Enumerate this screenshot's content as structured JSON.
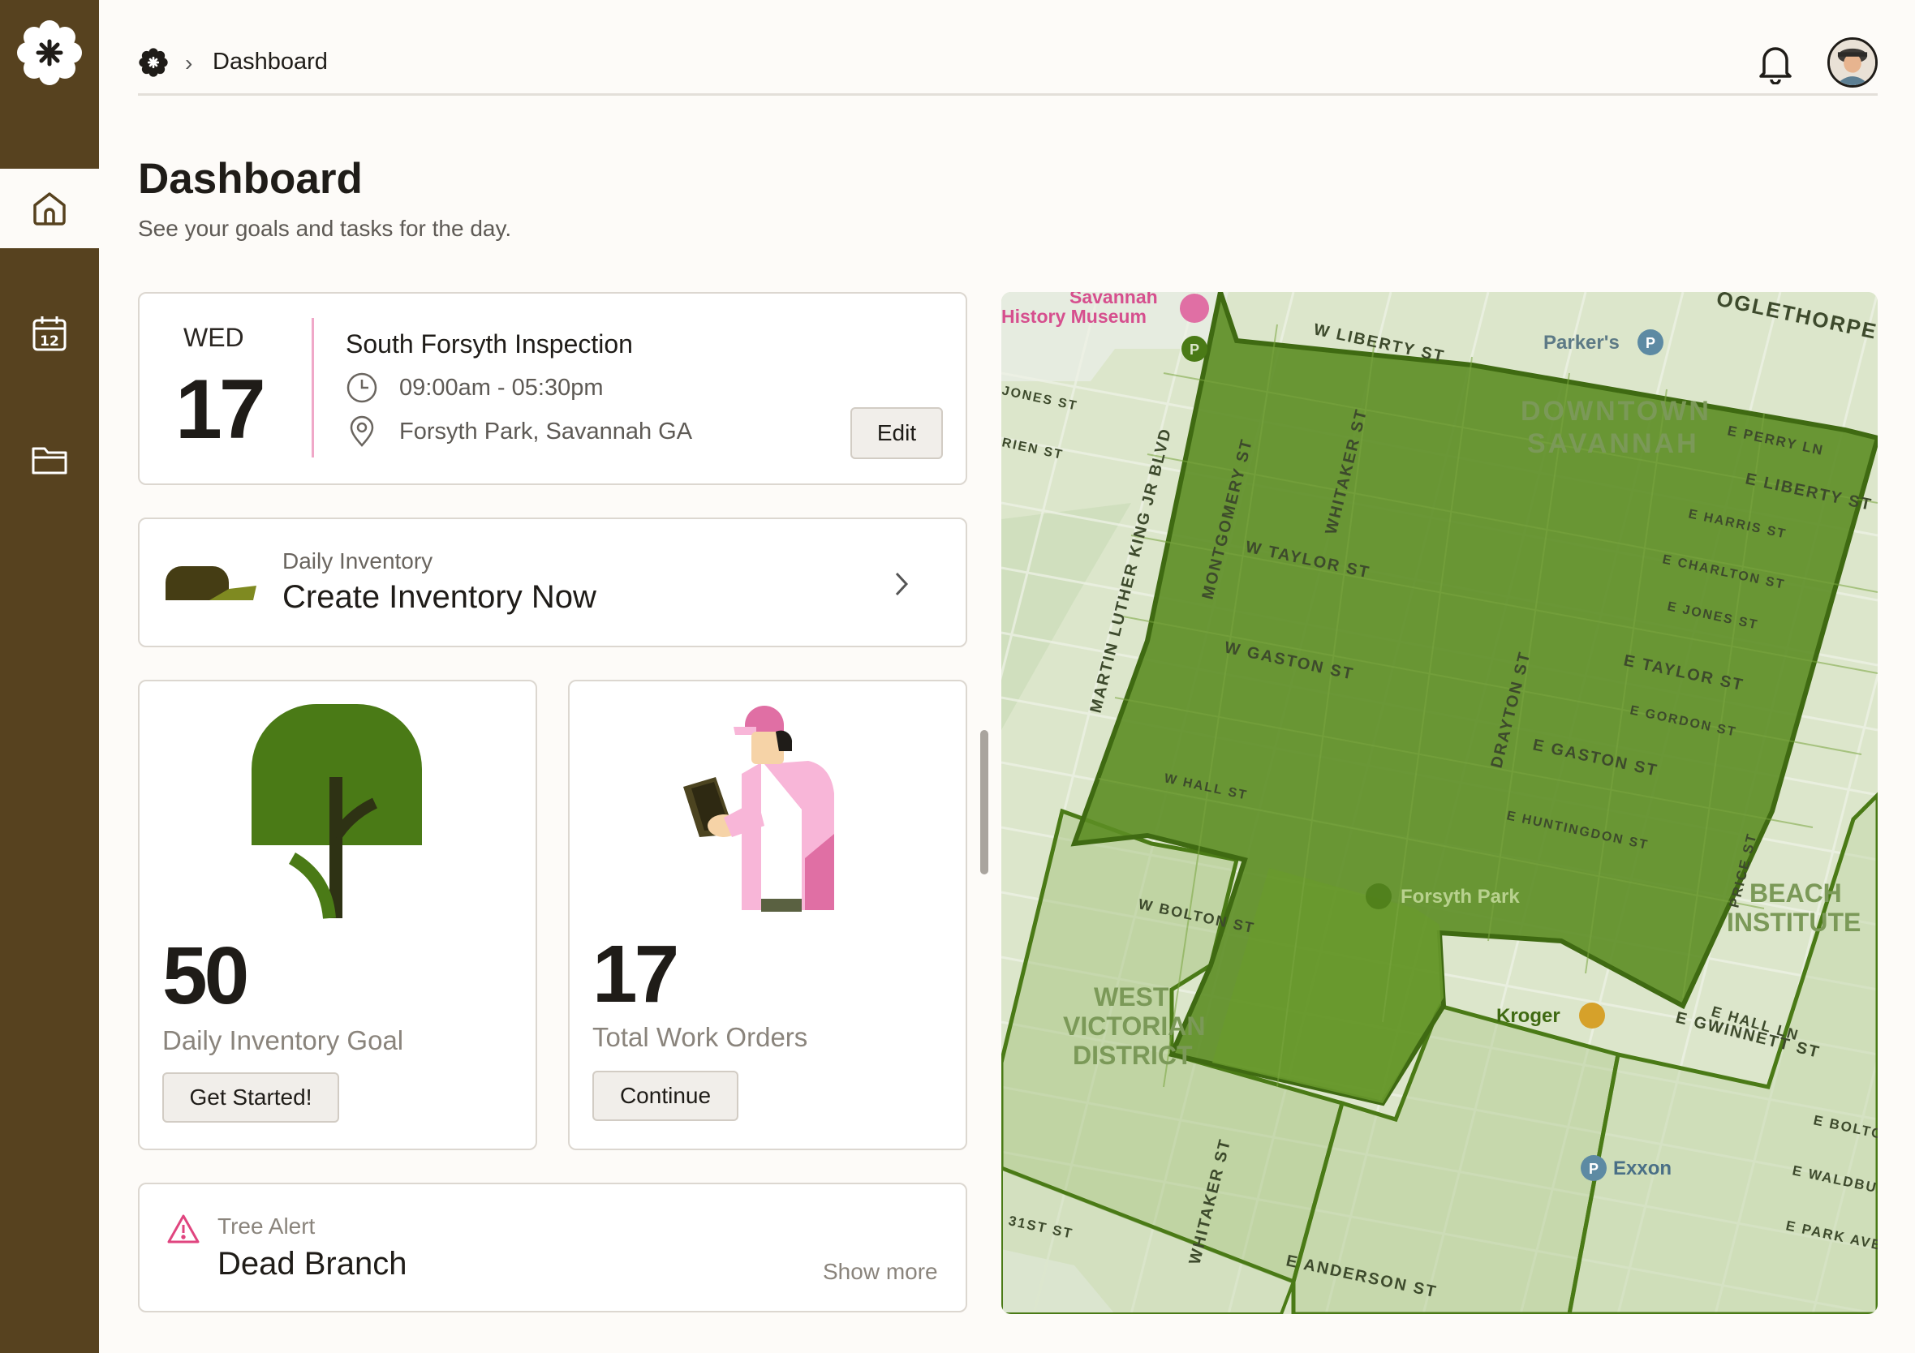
{
  "breadcrumb": {
    "current": "Dashboard"
  },
  "page": {
    "title": "Dashboard",
    "subtitle": "See your goals and tasks for the day."
  },
  "event": {
    "day": "WED",
    "date": "17",
    "title": "South Forsyth Inspection",
    "time": "09:00am - 05:30pm",
    "location": "Forsyth Park, Savannah GA",
    "edit_label": "Edit"
  },
  "inventory": {
    "label": "Daily Inventory",
    "title": "Create Inventory Now"
  },
  "stats": [
    {
      "value": "50",
      "label": "Daily Inventory Goal",
      "button": "Get Started!"
    },
    {
      "value": "17",
      "label": "Total Work Orders",
      "button": "Continue"
    }
  ],
  "alert": {
    "label": "Tree Alert",
    "title": "Dead Branch",
    "more": "Show more"
  },
  "map": {
    "labels": {
      "museum1": "Savannah",
      "museum2": "History Museum",
      "parkers": "Parker's",
      "downtown1": "DOWNTOWN",
      "downtown2": "SAVANNAH",
      "forsyth": "Forsyth Park",
      "kroger": "Kroger",
      "exxon": "Exxon",
      "westvic1": "WEST",
      "westvic2": "VICTORIAN",
      "westvic3": "DISTRICT",
      "beach1": "BEACH",
      "beach2": "INSTITUTE",
      "s_liberty": "W LIBERTY ST",
      "s_taylor": "W TAYLOR ST",
      "s_gaston": "W GASTON ST",
      "s_hall": "W HALL ST",
      "s_bolton": "W BOLTON ST",
      "s_etaylor": "E TAYLOR ST",
      "s_egaston": "E GASTON ST",
      "s_ehunt": "E HUNTINGDON ST",
      "s_eharris": "E HARRIS ST",
      "s_echarlton": "E CHARLTON ST",
      "s_ejones": "E JONES ST",
      "s_egordon": "E GORDON ST",
      "s_eliberty": "E LIBERTY ST",
      "s_eperry": "E PERRY LN",
      "s_oglethorpe": "OGLETHORPE A",
      "s_mlk": "MARTIN LUTHER KING JR BLVD",
      "s_montgomery": "MONTGOMERY ST",
      "s_whitaker": "WHITAKER ST",
      "s_drayton": "DRAYTON ST",
      "s_anderson": "E ANDERSON ST",
      "s_ehall": "E HALL LN",
      "s_gwinnett": "E GWINNETT ST",
      "s_31st": "31ST ST",
      "s_ebolton": "E BOLTO",
      "s_waldburg": "E WALDBUR",
      "s_epark": "E PARK AVE",
      "s_price": "PRICE ST",
      "s_jones": "JONES ST",
      "s_rien": "RIEN ST"
    }
  },
  "colors": {
    "sidebar": "#57421f",
    "accent": "#4a7a16",
    "pink": "#e06fa4"
  }
}
